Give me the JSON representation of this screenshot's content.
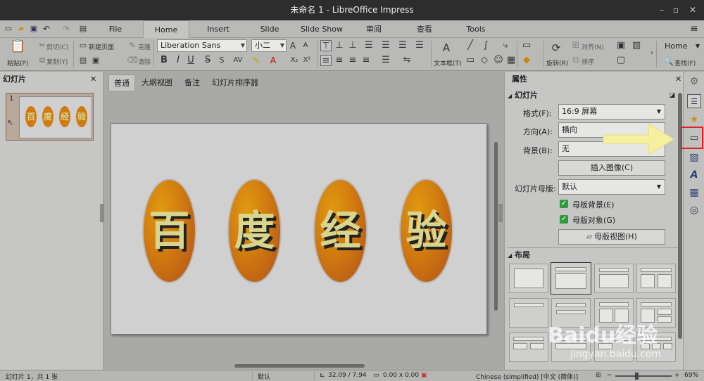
{
  "window": {
    "title": "未命名 1 - LibreOffice Impress",
    "minimize": "–",
    "restore": "▫",
    "close": "✕"
  },
  "tabs": [
    {
      "label": "File"
    },
    {
      "label": "Home"
    },
    {
      "label": "Insert"
    },
    {
      "label": "Slide"
    },
    {
      "label": "Slide Show"
    },
    {
      "label": "审阅"
    },
    {
      "label": "查看"
    },
    {
      "label": "Tools"
    }
  ],
  "menu_icon": "hamburger-icon",
  "toolbar": {
    "paste": "粘贴(P)",
    "cut": "剪切(C)",
    "copy": "复制(Y)",
    "new_slide": "新建页面",
    "clone": "克隆",
    "clear": "清除",
    "font_name": "Liberation Sans",
    "font_size": "小二",
    "textbox": "文本框(T)",
    "rotate": "旋转(R)",
    "align": "对齐(N)",
    "arrange": "排序",
    "style_box": "Home",
    "find": "查找(F)",
    "bold": "B",
    "italic": "I",
    "underline": "U",
    "strike": "S",
    "subscript": "X₂",
    "superscript": "X²"
  },
  "left_panel": {
    "title": "幻灯片",
    "slide_number": "1",
    "thumb_chars": [
      "百",
      "度",
      "经",
      "验"
    ]
  },
  "view_tabs": [
    "普通",
    "大纲视图",
    "备注",
    "幻灯片排序器"
  ],
  "slide": {
    "chars": [
      "百",
      "度",
      "经",
      "验"
    ]
  },
  "props": {
    "title": "属性",
    "section_slide": "幻灯片",
    "format_label": "格式(F):",
    "format_value": "16:9 屏幕",
    "orientation_label": "方向(A):",
    "orientation_value": "横向",
    "background_label": "背景(B):",
    "background_value": "无",
    "insert_image": "插入图像(C)",
    "master_label": "幻灯片母版:",
    "master_value": "默认",
    "master_bg": "母板背景(E)",
    "master_obj": "母版对象(G)",
    "master_view": "母版视图(H)",
    "section_layout": "布局"
  },
  "sidebar_icons": [
    "settings-icon",
    "properties-icon",
    "styles-icon",
    "slide-icon",
    "gallery-icon",
    "fontwork-icon",
    "image-icon",
    "navigator-icon"
  ],
  "status": {
    "slide_info": "幻灯片 1，共 1 张",
    "master": "默认",
    "position": "32.09 / 7.94",
    "size": "0.00 x 0.00",
    "language": "Chinese (simplified) [中文 (简体)]",
    "zoom": "69%"
  },
  "watermark": {
    "brand": "Baidu经验",
    "url": "jingyan.baidu.com"
  },
  "colors": {
    "highlight_box": "#e0202a",
    "arrow": "#f6efa0",
    "oval": "#d07a10",
    "text_gold": "#d8d58f"
  }
}
